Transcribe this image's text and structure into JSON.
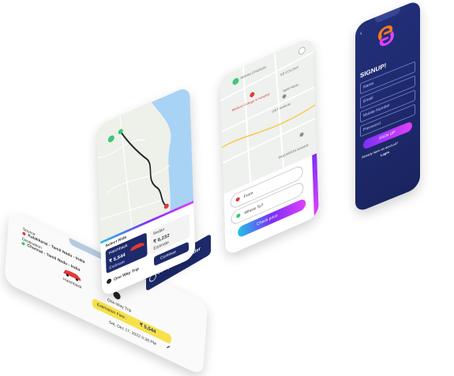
{
  "phone1": {
    "from_label": "Source",
    "from_value": "Kalakkarai - Tamil Nadu - India",
    "to_label": "Destination",
    "to_value": "Chennai - Tamil Nadu - India",
    "car_name": "Hatchback",
    "trip_type": "One-Way Trip",
    "est_label": "Estimation Fare :",
    "est_value": "₹ 5,544",
    "date_label": "Sat, Dec 17, 2022 5:38 PM",
    "cta_label": "Complete the order"
  },
  "phone2": {
    "fleet_label": "Select Ride",
    "car1_name": "Hatchback",
    "car1_price": "₹ 5,544",
    "car1_sub": "Estimate",
    "car2_name": "Sedan",
    "car2_price": "₹ 6,232",
    "car2_sub": "Estimate",
    "trip_label": "One Way Trip",
    "continue_label": "Continue"
  },
  "phone3": {
    "map_labels": [
      "INDIAN STADIUM",
      "SS COLONY",
      "Medical College & Hospital",
      "GRT Institute",
      "Tamil Nadu",
      "PASUMPON NAGAR"
    ],
    "from_label": "From",
    "to_label": "Where To?",
    "check_label": "Check price"
  },
  "phone4": {
    "back_icon": "chevron-left-icon",
    "title": "SIGNUP!",
    "name_placeholder": "Name",
    "email_placeholder": "Email",
    "phone_placeholder": "Mobile Number",
    "password_placeholder": "Password",
    "signup_label": "SIGN UP",
    "footer_text": "Already have an account?",
    "login_text": "Login"
  },
  "colors": {
    "navy": "#1d2a6b",
    "purple": "#7b2ff7",
    "pink": "#e040fb",
    "cyan": "#22c1e8",
    "yellow": "#f7e14b",
    "red": "#e53935",
    "green": "#2ecc71",
    "logo_orange": "#ff7a1a"
  }
}
